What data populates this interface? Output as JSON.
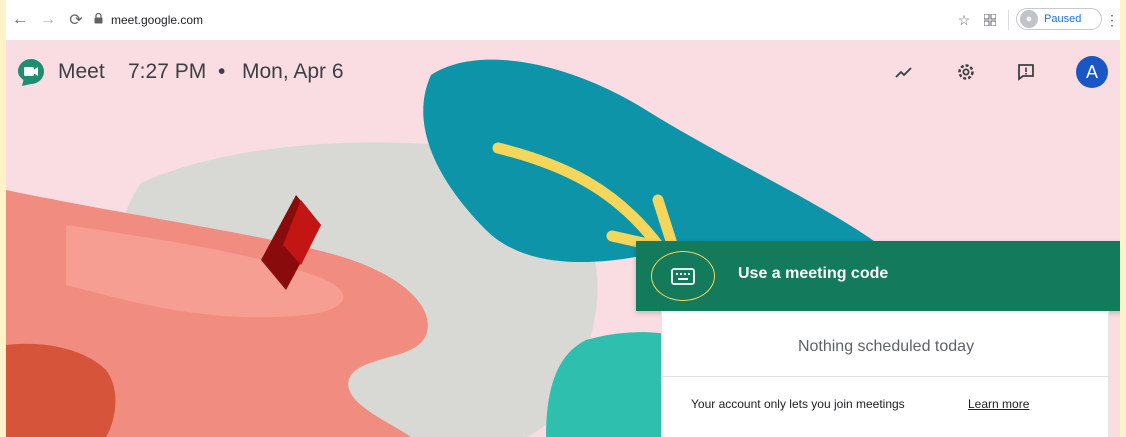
{
  "browser": {
    "url": "meet.google.com",
    "profile_status": "Paused"
  },
  "meet": {
    "app_name": "Meet",
    "time": "7:27 PM",
    "separator": "•",
    "date": "Mon, Apr 6",
    "account_initial": "A"
  },
  "card": {
    "code_button_label": "Use a meeting code",
    "nothing_scheduled": "Nothing scheduled today",
    "account_note": "Your account only lets you join meetings",
    "learn_more": "Learn more"
  },
  "colors": {
    "page_background": "#f9dde2",
    "code_button": "#137a5c",
    "account_avatar": "#1a56c4",
    "annotation_yellow": "#f3d65a"
  }
}
